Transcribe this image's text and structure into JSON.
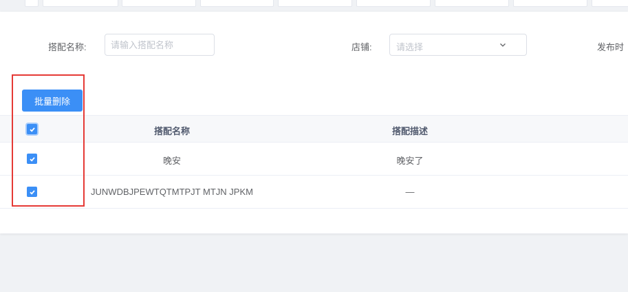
{
  "filters": {
    "name_label": "搭配名称:",
    "name_placeholder": "请输入搭配名称",
    "shop_label": "店铺:",
    "shop_placeholder": "请选择",
    "publish_label": "发布时"
  },
  "actions": {
    "batch_delete_label": "批量删除"
  },
  "table": {
    "columns": [
      "搭配名称",
      "搭配描述"
    ],
    "rows": [
      {
        "name": "晚安",
        "description": "晚安了",
        "checked": true
      },
      {
        "name": "JUNWDBJPEWTQTMTPJT MTJN JPKM",
        "description": "—",
        "checked": true
      }
    ],
    "select_all_checked": true
  },
  "colors": {
    "primary": "#3b8ff6",
    "highlight_border": "#e53935"
  }
}
